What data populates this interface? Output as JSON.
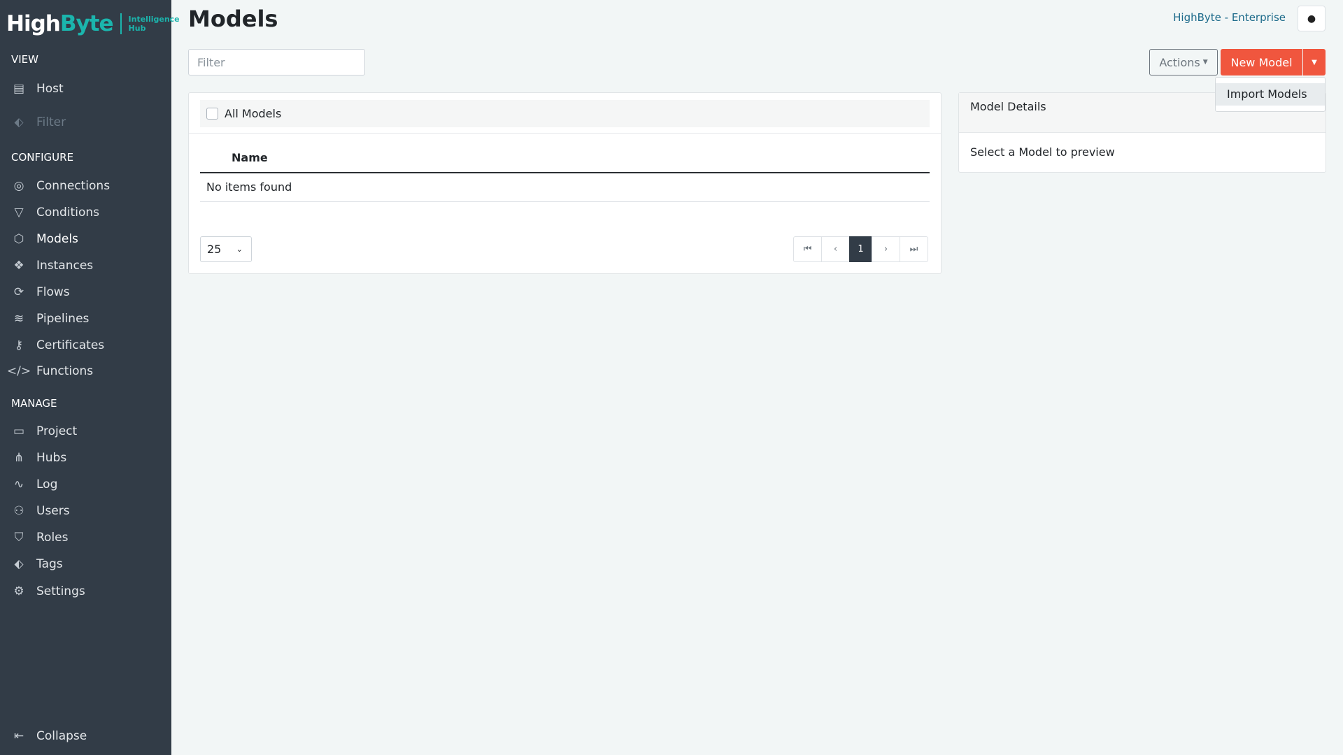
{
  "brand": {
    "logo_text": "HighByte",
    "logo_sub": "Intelligence Hub"
  },
  "sidebar": {
    "view_label": "VIEW",
    "view_items": [
      {
        "label": "Host",
        "icon": "server-icon"
      },
      {
        "label": "Filter",
        "icon": "tag-icon"
      }
    ],
    "configure_label": "CONFIGURE",
    "configure_items": [
      {
        "label": "Connections",
        "icon": "plug-icon"
      },
      {
        "label": "Conditions",
        "icon": "filter-icon"
      },
      {
        "label": "Models",
        "icon": "cube-icon"
      },
      {
        "label": "Instances",
        "icon": "cubes-icon"
      },
      {
        "label": "Flows",
        "icon": "sync-icon"
      },
      {
        "label": "Pipelines",
        "icon": "layers-icon"
      },
      {
        "label": "Certificates",
        "icon": "key-icon"
      },
      {
        "label": "Functions",
        "icon": "code-icon"
      }
    ],
    "manage_label": "MANAGE",
    "manage_items": [
      {
        "label": "Project",
        "icon": "archive-icon"
      },
      {
        "label": "Hubs",
        "icon": "sitemap-icon"
      },
      {
        "label": "Log",
        "icon": "pulse-icon"
      },
      {
        "label": "Users",
        "icon": "users-icon"
      },
      {
        "label": "Roles",
        "icon": "shield-icon"
      },
      {
        "label": "Tags",
        "icon": "tags-icon"
      },
      {
        "label": "Settings",
        "icon": "gear-icon"
      }
    ],
    "collapse_label": "Collapse"
  },
  "header": {
    "title": "Models",
    "enterprise": "HighByte - Enterprise"
  },
  "toolbar": {
    "filter_placeholder": "Filter",
    "actions_label": "Actions",
    "new_label": "New Model",
    "menu_items": [
      "Import Models"
    ]
  },
  "list": {
    "all_label": "All Models",
    "column": "Name",
    "empty": "No items found",
    "page_size": "25",
    "current_page": "1"
  },
  "details": {
    "title": "Model Details",
    "placeholder": "Select a Model to preview"
  },
  "colors": {
    "sidebar": "#323c47",
    "accent": "#f0563e",
    "brand": "#1bb5ad"
  }
}
